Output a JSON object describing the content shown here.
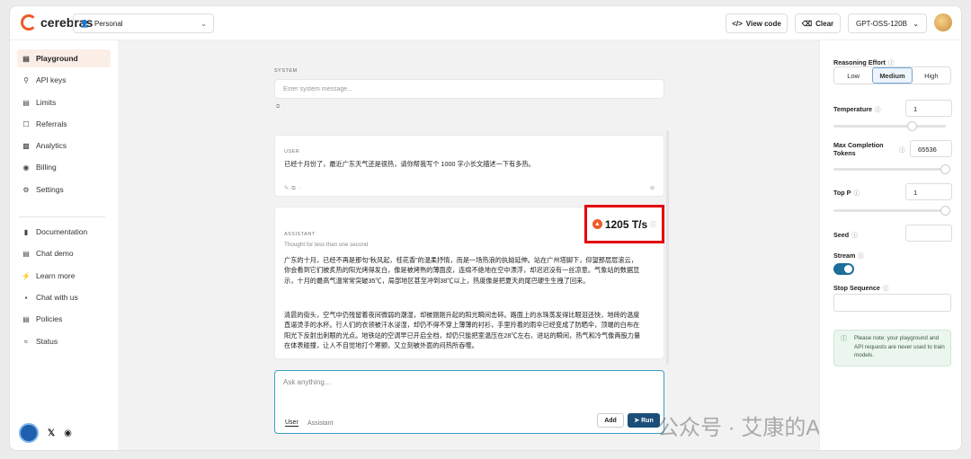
{
  "header": {
    "brand": "cerebras",
    "workspace": "Personal",
    "view_code": "View code",
    "clear": "Clear",
    "model": "GPT-OSS-120B"
  },
  "sidebar": {
    "items": [
      {
        "label": "Playground",
        "icon": "playground-icon"
      },
      {
        "label": "API keys",
        "icon": "key-icon"
      },
      {
        "label": "Limits",
        "icon": "limits-icon"
      },
      {
        "label": "Referrals",
        "icon": "gift-icon"
      },
      {
        "label": "Analytics",
        "icon": "chart-icon"
      },
      {
        "label": "Billing",
        "icon": "billing-icon"
      },
      {
        "label": "Settings",
        "icon": "gear-icon"
      }
    ],
    "secondary": [
      {
        "label": "Documentation",
        "icon": "book-icon"
      },
      {
        "label": "Chat demo",
        "icon": "chat-icon"
      },
      {
        "label": "Learn more",
        "icon": "bolt-icon"
      },
      {
        "label": "Chat with us",
        "icon": "message-icon"
      },
      {
        "label": "Policies",
        "icon": "document-icon"
      },
      {
        "label": "Status",
        "icon": "status-icon"
      }
    ]
  },
  "main": {
    "system_label": "SYSTEM",
    "system_placeholder": "Enter system message...",
    "user_label": "USER",
    "user_message": "已经十月份了，最近广东天气还是很热，请你帮我写个 1000 字小长文描述一下有多热。",
    "assistant_label": "ASSISTANT",
    "thought": "Thought for less than one second",
    "speed": "1205 T/s",
    "assistant_p1": "广东的十月，已经不再是那句“秋风起，桂花香”的温柔抒情，而是一场热浪的执拗延伸。站在广州塔脚下，仰望那层层滚云，你会看到它们被炙热的阳光烤得发白，像是被烤熟的薄面皮，连绵不绝地在空中漂浮，却迟迟没有一丝凉意。气象站的数据显示，十月的最高气温常常突破35℃，局部地区甚至冲到38℃以上，热度像是把夏天的尾巴硬生生拽了回来。",
    "assistant_p2": "清晨的街头，空气中仍残留着夜间微弱的潮湿，却被刚刚升起的阳光瞬间击碎。路面上的水珠蒸发得比眼泪还快，地砖的温度直逼烫手的水杯。行人们的衣领被汗水浸湿，却仍不得不穿上薄薄的衬衫，手里拎着的雨伞已经变成了防晒伞，顶端的白布在阳光下反射出刺眼的光点。地铁站的空调早已开启全档，却仍只能把室温压在28℃左右，进站的瞬间，热气和冷气像两股力量在体表碰撞，让人不自觉地打个寒颤，又立刻被外面的闷热所吞噬。",
    "chat_placeholder": "Ask anything...",
    "tab_user": "User",
    "tab_assistant": "Assistant",
    "add": "Add",
    "run": "Run",
    "watermark": "公众号 · 艾康的AI自留地"
  },
  "panel": {
    "reasoning_label": "Reasoning Effort",
    "effort_options": [
      "Low",
      "Medium",
      "High"
    ],
    "effort_selected": "Medium",
    "temperature_label": "Temperature",
    "temperature_value": "1",
    "temperature_fraction": 0.7,
    "max_tokens_label_1": "Max Completion",
    "max_tokens_label_2": "Tokens",
    "max_tokens_value": "65536",
    "max_tokens_fraction": 1.0,
    "top_p_label": "Top P",
    "top_p_value": "1",
    "top_p_fraction": 1.0,
    "seed_label": "Seed",
    "stream_label": "Stream",
    "stop_label": "Stop Sequence",
    "note": "Please note: your playground and API requests are never used to train models."
  },
  "colors": {
    "accent": "#f05a28",
    "run": "#1c4e7a",
    "highlight": "#e3000f",
    "toggle": "#1d6e9a"
  }
}
